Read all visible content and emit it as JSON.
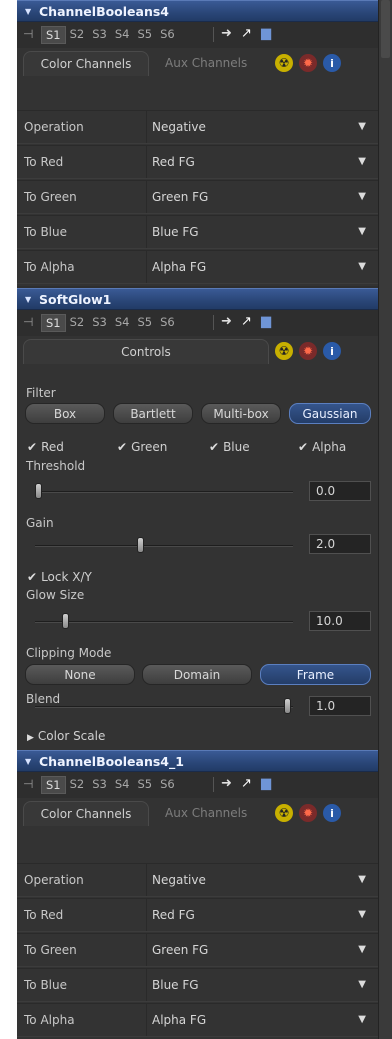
{
  "slots": [
    "S1",
    "S2",
    "S3",
    "S4",
    "S5",
    "S6"
  ],
  "channel_booleans_1": {
    "title": "ChannelBooleans4",
    "tabs": [
      "Color Channels",
      "Aux Channels"
    ],
    "rows": [
      {
        "label": "Operation",
        "value": "Negative"
      },
      {
        "label": "To Red",
        "value": "Red   FG"
      },
      {
        "label": "To Green",
        "value": "Green FG"
      },
      {
        "label": "To Blue",
        "value": "Blue   FG"
      },
      {
        "label": "To Alpha",
        "value": "Alpha  FG"
      }
    ]
  },
  "soft_glow": {
    "title": "SoftGlow1",
    "tab": "Controls",
    "filter_label": "Filter",
    "filters": [
      "Box",
      "Bartlett",
      "Multi-box",
      "Gaussian"
    ],
    "filter_selected": "Gaussian",
    "channels": [
      {
        "label": "Red",
        "checked": true
      },
      {
        "label": "Green",
        "checked": true
      },
      {
        "label": "Blue",
        "checked": true
      },
      {
        "label": "Alpha",
        "checked": true
      }
    ],
    "threshold": {
      "label": "Threshold",
      "value": "0.0",
      "fraction": 0.0
    },
    "gain": {
      "label": "Gain",
      "value": "2.0",
      "fraction": 0.4
    },
    "lock_xy": {
      "label": "Lock X/Y",
      "checked": true
    },
    "glow_size": {
      "label": "Glow Size",
      "value": "10.0",
      "fraction": 0.1
    },
    "clipping": {
      "label": "Clipping Mode",
      "options": [
        "None",
        "Domain",
        "Frame"
      ],
      "selected": "Frame"
    },
    "blend": {
      "label": "Blend",
      "value": "1.0",
      "fraction": 1.0
    },
    "color_scale_label": "Color Scale"
  },
  "channel_booleans_2": {
    "title": "ChannelBooleans4_1",
    "tabs": [
      "Color Channels",
      "Aux Channels"
    ],
    "rows": [
      {
        "label": "Operation",
        "value": "Negative"
      },
      {
        "label": "To Red",
        "value": "Red   FG"
      },
      {
        "label": "To Green",
        "value": "Green FG"
      },
      {
        "label": "To Blue",
        "value": "Blue   FG"
      },
      {
        "label": "To Alpha",
        "value": "Alpha  FG"
      }
    ]
  },
  "colors": {
    "header": "#2a4677",
    "selected": "#35558c",
    "accent_icon_radio": "#c8b000",
    "accent_icon_gear": "#c0392b",
    "accent_icon_info": "#2a5aa8"
  }
}
